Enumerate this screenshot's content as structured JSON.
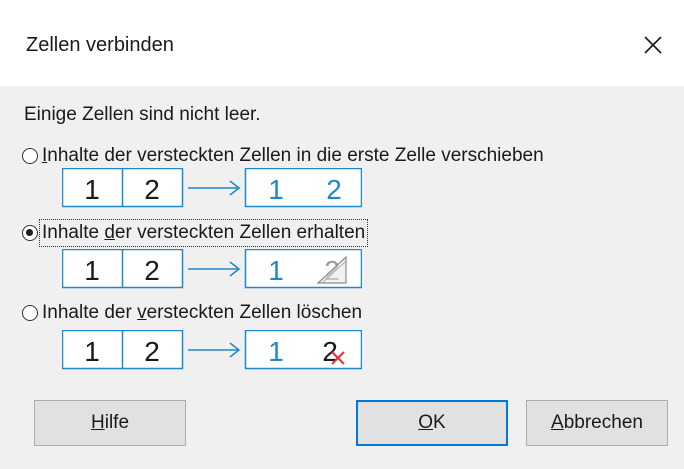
{
  "dialog": {
    "title": "Zellen verbinden",
    "intro": "Einige Zellen sind nicht leer."
  },
  "options": [
    {
      "label_pre": "",
      "label_ul": "I",
      "label_post": "nhalte der versteckten Zellen in die erste Zelle verschieben",
      "selected": false,
      "cells_before": [
        "1",
        "2"
      ],
      "cells_after": [
        "1",
        "2"
      ]
    },
    {
      "label_pre": "Inhalte ",
      "label_ul": "d",
      "label_post": "er versteckten Zellen erhalten",
      "selected": true,
      "cells_before": [
        "1",
        "2"
      ],
      "cells_after": [
        "1",
        "2"
      ]
    },
    {
      "label_pre": "Inhalte der ",
      "label_ul": "v",
      "label_post": "ersteckten Zellen löschen",
      "selected": false,
      "cells_before": [
        "1",
        "2"
      ],
      "cells_after": [
        "1",
        "2"
      ]
    }
  ],
  "buttons": {
    "help_ul": "H",
    "help_rest": "ilfe",
    "ok_ul": "O",
    "ok_rest": "K",
    "cancel_ul": "A",
    "cancel_rest": "bbrechen"
  },
  "colors": {
    "accent": "#0078d7",
    "cell_blue": "#1f87cc",
    "delete_red": "#e0343a"
  },
  "icons": {
    "close": "close-icon",
    "arrow": "arrow-right-icon",
    "hidden_marker": "hidden-triangle-icon",
    "delete_marker": "delete-x-icon"
  }
}
